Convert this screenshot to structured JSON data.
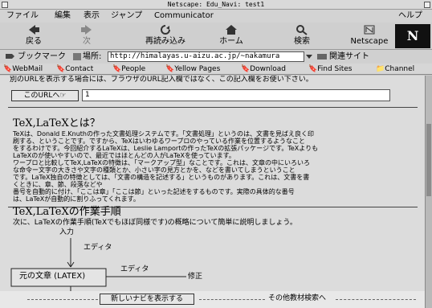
{
  "window": {
    "title": "Netscape: Edu_Navi: test1"
  },
  "menu": [
    "ファイル",
    "編集",
    "表示",
    "ジャンプ",
    "Communicator",
    "ヘルプ"
  ],
  "toolbar": {
    "back": "戻る",
    "forward": "次",
    "reload": "再読み込み",
    "home": "ホーム",
    "search": "検索",
    "netscape": "Netscape",
    "logo": "N"
  },
  "location": {
    "bookmarks": "ブックマーク",
    "label": "場所:",
    "url": "http://himalayas.u-aizu.ac.jp/~nakamura",
    "related": "関連サイト"
  },
  "personal": [
    "WebMail",
    "Contact",
    "People",
    "Yellow Pages",
    "Download",
    "Find Sites",
    "Channel"
  ],
  "content": {
    "top_note": "別のURLを表示する場合には、ブラウザのURL記入欄ではなく、この記入欄をお使い下さい。",
    "url_button": "このURLへ☞",
    "url_value": "1",
    "section1_title": "TeX,LaTeXとは？",
    "para1": [
      "TeXは、Donald E.Knuthの作った文書処理システムです。「文書処理」というのは、文書を見ばえ良く印",
      "刷する、ということです。ですから、TeXはいわゆるワープロのやっている作業を位置するようなこと",
      "をするわけです。今回紹介するLaTeXは、Leslie Lamportの作ったTeXの拡張パッケージです。TeXよりも",
      "LaTeXのが使いやすいので、最近ではほとんどの人がLaTeXを使っています。",
      "ワープロと比較してTeX,LaTeXの特徴は、「マークアップ型」なことです。これは、文章の中にいろいろ",
      "な命令ー文字の大きさや文字の種類とか、小さい字の見方とかを、などを書いてしまうということ",
      "です。LaTeX独自の特徴としては、「文書の構造を記述する」というものがあります。これは、文書を書",
      "くときに、章、節、段落などや",
      "番号を自動的に付け、「ここは章」「ここは節」といった記述をするものです。実際の具体的な番号",
      "は、LaTeXが自動的に割りふってくれます。"
    ],
    "section2_title": "TeX,LaTeXの作業手順",
    "para2": "次に、LaTeXの作業手順(TeXでもほぼ同様です)の概略について簡単に説明しましょう。",
    "diagram": {
      "input": "入力",
      "editor1": "エディタ",
      "box": "元の文章 (LATEX)",
      "editor2": "エディタ",
      "fix": "修正"
    },
    "bottom_button": "新しいナビを表示する",
    "bottom_link": "その他教材検索へ"
  }
}
